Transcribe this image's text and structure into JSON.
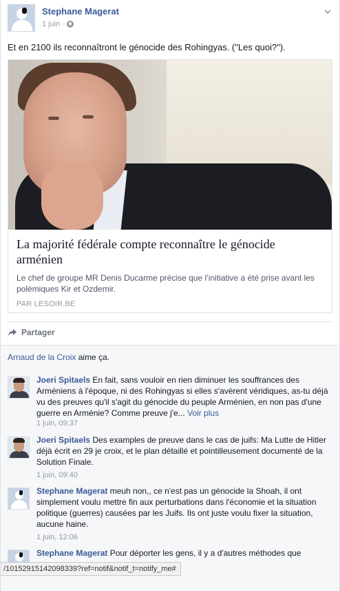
{
  "post": {
    "author": "Stephane Magerat",
    "date": "1 juin ·",
    "text": "Et en 2100 ils reconnaîtront le génocide des Rohingyas. (\"Les quoi?\").",
    "link": {
      "title": "La majorité fédérale compte reconnaître le génocide arménien",
      "description": "Le chef de groupe MR Denis Ducarme précise que l’initiative a été prise avant les polémiques Kir et Ozdemir.",
      "source": "PAR LESOIR.BE"
    }
  },
  "actions": {
    "share_label": "Partager"
  },
  "likes": {
    "liker": "Arnaud de la Croix",
    "suffix": " aime ça."
  },
  "comments": [
    {
      "author": "Joeri Spitaels",
      "text": " En fait, sans vouloir en rien diminuer les souffrances des Arméniens à l'époque, ni des Rohingyas si elles s'avèrent véridiques, as-tu déjà vu des preuves qu'il s'agit du génocide du peuple Arménien, en non pas d'une guerre en Arménie? Comme preuve j'e...",
      "see_more": " Voir plus",
      "time": "1 juin, 09:37"
    },
    {
      "author": "Joeri Spitaels",
      "text": " Des examples de preuve dans le cas de juifs: Ma Lutte de Hitler déjà écrit en 29 je croix, et le plan détaillé et pointilleusement documenté de la Solution Finale.",
      "time": "1 juin, 09:40"
    },
    {
      "author": "Stephane Magerat",
      "text": " meuh non,, ce n'est pas un génocide la Shoah, il ont simplement voulu mettre fin aux perturbations dans l'économie et la situation politique (guerres) causées par les Juifs. Ils ont juste voulu fixer la situation, aucune haine.",
      "time": "1 juin, 12:06"
    },
    {
      "author": "Stephane Magerat",
      "text": " Pour déporter les gens, il y a d'autres méthodes que"
    }
  ],
  "status_url": "/10152915142098339?ref=notif&notif_t=notify_me#"
}
